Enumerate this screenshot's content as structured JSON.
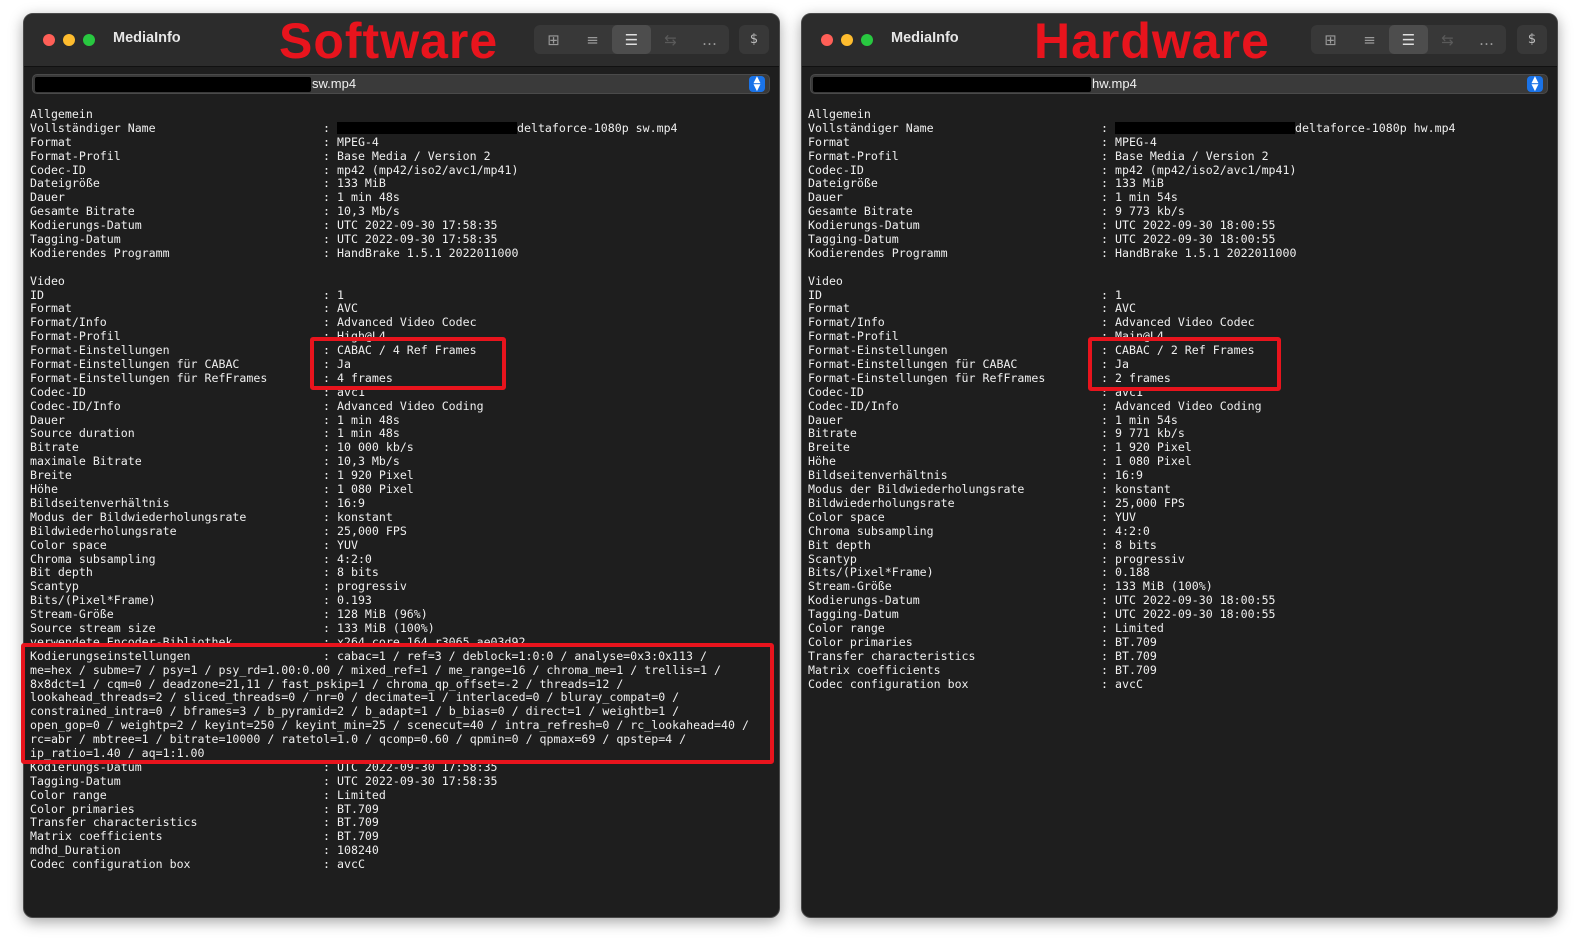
{
  "left": {
    "app_title": "MediaInfo",
    "overlay_label": "Software",
    "file_name": "sw.mp4",
    "sections": [
      {
        "title": "Allgemein",
        "rows": [
          {
            "k": "Vollständiger Name",
            "v": "deltaforce-1080p sw.mp4",
            "redacted": true
          },
          {
            "k": "Format",
            "v": "MPEG-4"
          },
          {
            "k": "Format-Profil",
            "v": "Base Media / Version 2"
          },
          {
            "k": "Codec-ID",
            "v": "mp42 (mp42/iso2/avc1/mp41)"
          },
          {
            "k": "Dateigröße",
            "v": "133 MiB"
          },
          {
            "k": "Dauer",
            "v": "1 min 48s"
          },
          {
            "k": "Gesamte Bitrate",
            "v": "10,3 Mb/s"
          },
          {
            "k": "Kodierungs-Datum",
            "v": "UTC 2022-09-30 17:58:35"
          },
          {
            "k": "Tagging-Datum",
            "v": "UTC 2022-09-30 17:58:35"
          },
          {
            "k": "Kodierendes Programm",
            "v": "HandBrake 1.5.1 2022011000"
          }
        ]
      },
      {
        "title": "Video",
        "rows": [
          {
            "k": "ID",
            "v": "1"
          },
          {
            "k": "Format",
            "v": "AVC"
          },
          {
            "k": "Format/Info",
            "v": "Advanced Video Codec"
          },
          {
            "k": "Format-Profil",
            "v": "High@L4"
          },
          {
            "k": "Format-Einstellungen",
            "v": "CABAC / 4 Ref Frames"
          },
          {
            "k": "Format-Einstellungen für CABAC",
            "v": "Ja"
          },
          {
            "k": "Format-Einstellungen für RefFrames",
            "v": "4 frames"
          },
          {
            "k": "Codec-ID",
            "v": "avc1"
          },
          {
            "k": "Codec-ID/Info",
            "v": "Advanced Video Coding"
          },
          {
            "k": "Dauer",
            "v": "1 min 48s"
          },
          {
            "k": "Source duration",
            "v": "1 min 48s"
          },
          {
            "k": "Bitrate",
            "v": "10 000 kb/s"
          },
          {
            "k": "maximale Bitrate",
            "v": "10,3 Mb/s"
          },
          {
            "k": "Breite",
            "v": "1 920 Pixel"
          },
          {
            "k": "Höhe",
            "v": "1 080 Pixel"
          },
          {
            "k": "Bildseitenverhältnis",
            "v": "16:9"
          },
          {
            "k": "Modus der Bildwiederholungsrate",
            "v": "konstant"
          },
          {
            "k": "Bildwiederholungsrate",
            "v": "25,000 FPS"
          },
          {
            "k": "Color space",
            "v": "YUV"
          },
          {
            "k": "Chroma subsampling",
            "v": "4:2:0"
          },
          {
            "k": "Bit depth",
            "v": "8 bits"
          },
          {
            "k": "Scantyp",
            "v": "progressiv"
          },
          {
            "k": "Bits/(Pixel*Frame)",
            "v": "0.193"
          },
          {
            "k": "Stream-Größe",
            "v": "128 MiB (96%)"
          },
          {
            "k": "Source stream size",
            "v": "133 MiB (100%)"
          },
          {
            "k": "verwendete Encoder-Bibliothek",
            "v": "x264 core 164 r3065 ae03d92"
          }
        ]
      }
    ],
    "encoder_settings_label": "Kodierungseinstellungen",
    "encoder_settings_lines": [
      "cabac=1 / ref=3 / deblock=1:0:0 / analyse=0x3:0x113 /",
      "me=hex / subme=7 / psy=1 / psy_rd=1.00:0.00 / mixed_ref=1 / me_range=16 / chroma_me=1 / trellis=1 /",
      "8x8dct=1 / cqm=0 / deadzone=21,11 / fast_pskip=1 / chroma_qp_offset=-2 / threads=12 /",
      "lookahead_threads=2 / sliced_threads=0 / nr=0 / decimate=1 / interlaced=0 / bluray_compat=0 /",
      "constrained_intra=0 / bframes=3 / b_pyramid=2 / b_adapt=1 / b_bias=0 / direct=1 / weightb=1 /",
      "open_gop=0 / weightp=2 / keyint=250 / keyint_min=25 / scenecut=40 / intra_refresh=0 / rc_lookahead=40 /",
      "rc=abr / mbtree=1 / bitrate=10000 / ratetol=1.0 / qcomp=0.60 / qpmin=0 / qpmax=69 / qpstep=4 /",
      "ip_ratio=1.40 / aq=1:1.00"
    ],
    "after_rows": [
      {
        "k": "Kodierungs-Datum",
        "v": "UTC 2022-09-30 17:58:35"
      },
      {
        "k": "Tagging-Datum",
        "v": "UTC 2022-09-30 17:58:35"
      },
      {
        "k": "Color range",
        "v": "Limited"
      },
      {
        "k": "Color primaries",
        "v": "BT.709"
      },
      {
        "k": "Transfer characteristics",
        "v": "BT.709"
      },
      {
        "k": "Matrix coefficients",
        "v": "BT.709"
      },
      {
        "k": "mdhd_Duration",
        "v": "108240"
      },
      {
        "k": "Codec configuration box",
        "v": "avcC"
      }
    ]
  },
  "right": {
    "app_title": "MediaInfo",
    "overlay_label": "Hardware",
    "file_name": "hw.mp4",
    "sections": [
      {
        "title": "Allgemein",
        "rows": [
          {
            "k": "Vollständiger Name",
            "v": "deltaforce-1080p hw.mp4",
            "redacted": true
          },
          {
            "k": "Format",
            "v": "MPEG-4"
          },
          {
            "k": "Format-Profil",
            "v": "Base Media / Version 2"
          },
          {
            "k": "Codec-ID",
            "v": "mp42 (mp42/iso2/avc1/mp41)"
          },
          {
            "k": "Dateigröße",
            "v": "133 MiB"
          },
          {
            "k": "Dauer",
            "v": "1 min 54s"
          },
          {
            "k": "Gesamte Bitrate",
            "v": "9 773 kb/s"
          },
          {
            "k": "Kodierungs-Datum",
            "v": "UTC 2022-09-30 18:00:55"
          },
          {
            "k": "Tagging-Datum",
            "v": "UTC 2022-09-30 18:00:55"
          },
          {
            "k": "Kodierendes Programm",
            "v": "HandBrake 1.5.1 2022011000"
          }
        ]
      },
      {
        "title": "Video",
        "rows": [
          {
            "k": "ID",
            "v": "1"
          },
          {
            "k": "Format",
            "v": "AVC"
          },
          {
            "k": "Format/Info",
            "v": "Advanced Video Codec"
          },
          {
            "k": "Format-Profil",
            "v": "Main@L4"
          },
          {
            "k": "Format-Einstellungen",
            "v": "CABAC / 2 Ref Frames"
          },
          {
            "k": "Format-Einstellungen für CABAC",
            "v": "Ja"
          },
          {
            "k": "Format-Einstellungen für RefFrames",
            "v": "2 frames"
          },
          {
            "k": "Codec-ID",
            "v": "avc1"
          },
          {
            "k": "Codec-ID/Info",
            "v": "Advanced Video Coding"
          },
          {
            "k": "Dauer",
            "v": "1 min 54s"
          },
          {
            "k": "Bitrate",
            "v": "9 771 kb/s"
          },
          {
            "k": "Breite",
            "v": "1 920 Pixel"
          },
          {
            "k": "Höhe",
            "v": "1 080 Pixel"
          },
          {
            "k": "Bildseitenverhältnis",
            "v": "16:9"
          },
          {
            "k": "Modus der Bildwiederholungsrate",
            "v": "konstant"
          },
          {
            "k": "Bildwiederholungsrate",
            "v": "25,000 FPS"
          },
          {
            "k": "Color space",
            "v": "YUV"
          },
          {
            "k": "Chroma subsampling",
            "v": "4:2:0"
          },
          {
            "k": "Bit depth",
            "v": "8 bits"
          },
          {
            "k": "Scantyp",
            "v": "progressiv"
          },
          {
            "k": "Bits/(Pixel*Frame)",
            "v": "0.188"
          },
          {
            "k": "Stream-Größe",
            "v": "133 MiB (100%)"
          },
          {
            "k": "Kodierungs-Datum",
            "v": "UTC 2022-09-30 18:00:55"
          },
          {
            "k": "Tagging-Datum",
            "v": "UTC 2022-09-30 18:00:55"
          },
          {
            "k": "Color range",
            "v": "Limited"
          },
          {
            "k": "Color primaries",
            "v": "BT.709"
          },
          {
            "k": "Transfer characteristics",
            "v": "BT.709"
          },
          {
            "k": "Matrix coefficients",
            "v": "BT.709"
          },
          {
            "k": "Codec configuration box",
            "v": "avcC"
          }
        ]
      }
    ]
  },
  "toolbar_icons": [
    "grid-view-icon",
    "tree-view-icon",
    "text-view-icon",
    "compare-icon",
    "more-icon",
    "dollar-icon"
  ],
  "colors": {
    "highlight": "#e8141d",
    "window_bg": "#1e1e1e",
    "titlebar_bg": "#2c2c2c",
    "select_accent": "#1a73e8"
  }
}
